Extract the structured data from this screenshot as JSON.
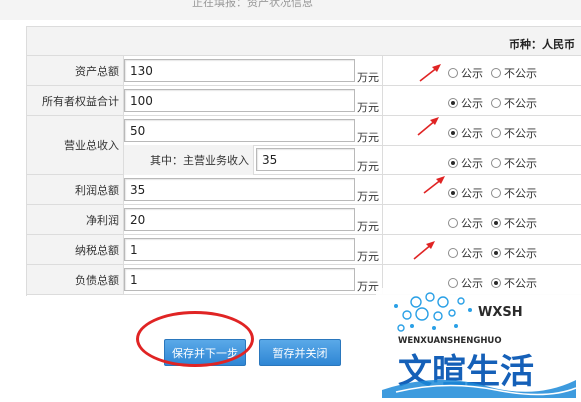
{
  "header": {
    "breadcrumb": "正在填报：资产状况信息"
  },
  "currency_label": "币种：人民币",
  "unit": "万元",
  "disclose_options": {
    "public": "公示",
    "not_public": "不公示"
  },
  "fields": [
    {
      "label": "资产总额",
      "value": "130",
      "disclose": "none"
    },
    {
      "label": "所有者权益合计",
      "value": "100",
      "disclose": "public"
    },
    {
      "label": "营业总收入",
      "value": "50",
      "disclose": "public"
    },
    {
      "label": "其中：主营业务收入",
      "value": "35",
      "disclose": "public"
    },
    {
      "label": "利润总额",
      "value": "35",
      "disclose": "public"
    },
    {
      "label": "净利润",
      "value": "20",
      "disclose": "not_public"
    },
    {
      "label": "纳税总额",
      "value": "1",
      "disclose": "not_public"
    },
    {
      "label": "负债总额",
      "value": "1",
      "disclose": "not_public"
    }
  ],
  "buttons": {
    "save_next": "保存并下一步",
    "save_close": "暂存并关闭"
  },
  "watermark": {
    "brand_en": "WENXUANSHENGHUO",
    "brand_cn": "文暄生活",
    "mark": "WXSH"
  },
  "colors": {
    "accent_blue": "#2f86d4",
    "annotation_red": "#e02424",
    "logo_blue": "#1560b8"
  }
}
